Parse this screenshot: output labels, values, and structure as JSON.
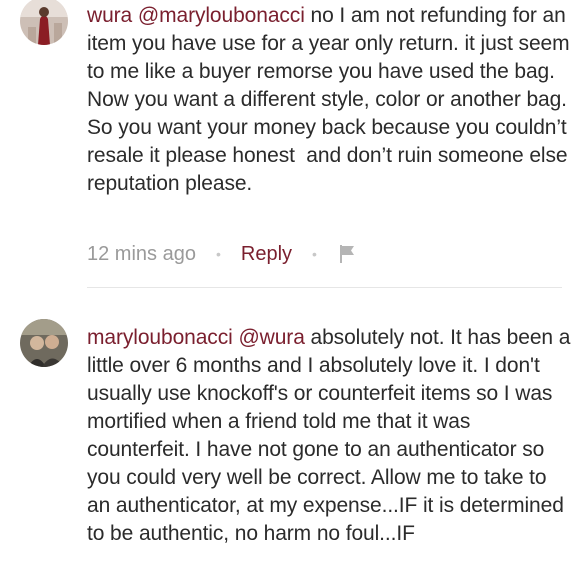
{
  "comments": [
    {
      "author": "wura",
      "mention": "@maryloubonacci",
      "body": " no I am not refunding for an item you have use for a year only return. it just seem to me like a buyer remorse you have used the bag. Now you want a different style, color or another bag. So you want your money back because you couldn’t resale it please honest  and don’t ruin someone else reputation please.",
      "time": "12 mins ago",
      "reply_label": "Reply"
    },
    {
      "author": "maryloubonacci",
      "mention": "@wura",
      "body": " absolutely not. It has been a little over 6 months and I absolutely love it. I don't usually use knockoff's or counterfeit items so I was mortified when a friend told me that it was counterfeit. I have not gone to an authenticator so you could very well be correct. Allow me to take to an authenticator, at my expense...IF it is determined to be authentic, no harm no foul...IF"
    }
  ],
  "colors": {
    "accent": "#7a1f2e",
    "text": "#2b2b2b",
    "meta": "#9a9a9a"
  }
}
